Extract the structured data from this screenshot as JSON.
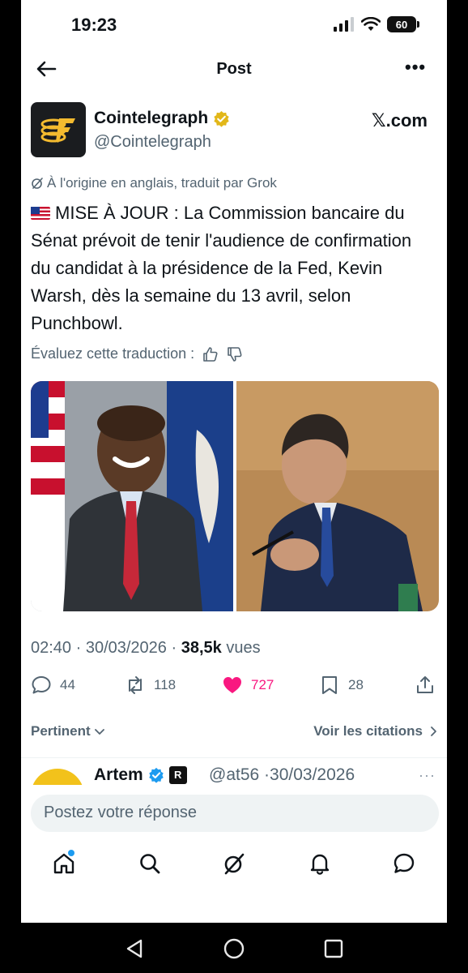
{
  "status_bar": {
    "time": "19:23",
    "battery": "60",
    "icons": [
      "signal-icon",
      "wifi-icon",
      "battery-icon"
    ]
  },
  "header": {
    "title": "Post",
    "back_icon": "back-arrow-icon",
    "more_icon": "more-icon"
  },
  "tweet": {
    "author_name": "Cointelegraph",
    "author_handle": "@Cointelegraph",
    "source": "𝕏.com",
    "translation_note": "À l'origine en anglais, traduit par Grok",
    "text": "MISE À JOUR : La Commission bancaire du Sénat prévoit de tenir l'audience de confirmation du candidat à la présidence de la Fed, Kevin Warsh, dès la semaine du 13 avril, selon Punchbowl.",
    "rate_label": "Évaluez cette traduction :",
    "timestamp": "02:40 · 30/03/2026 · ",
    "views_count": "38,5k",
    "views_label": " vues",
    "stats": {
      "replies": "44",
      "reposts": "118",
      "likes": "727",
      "bookmarks": "28"
    },
    "colors": {
      "like": "#f91880",
      "verified": "#e2b719"
    }
  },
  "replies": {
    "sort_label": "Pertinent",
    "quotes_label": "Voir les citations",
    "first_reply": {
      "name": "Artem",
      "handle": "@at56",
      "date": "·30/03/2026",
      "more": "···"
    }
  },
  "composer": {
    "placeholder": "Postez votre réponse"
  },
  "tabbar": {
    "items": [
      "home-icon",
      "search-icon",
      "grok-icon",
      "notifications-icon",
      "messages-icon"
    ]
  },
  "android_nav": {
    "items": [
      "back-triangle-icon",
      "home-circle-icon",
      "recents-square-icon"
    ]
  }
}
